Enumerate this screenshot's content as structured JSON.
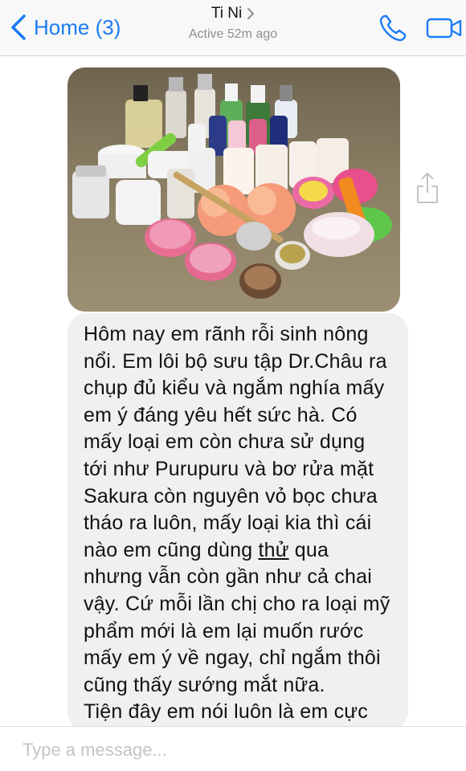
{
  "header": {
    "back_label": "Home (3)",
    "contact_name": "Ti Ni",
    "status": "Active 52m ago",
    "accent_color": "#1b7bf5",
    "icons": [
      "chevron-left-icon",
      "chevron-right-icon",
      "phone-icon",
      "video-camera-icon"
    ]
  },
  "messages": [
    {
      "type": "image",
      "sender": "contact",
      "icon": "share-icon"
    },
    {
      "type": "text",
      "sender": "contact",
      "text_before": "Hôm nay em rãnh rỗi sinh nông\nnổi. Em lôi bộ sưu tập Dr.Châu ra\nchụp đủ kiểu và ngắm nghía mấy\nem ý đáng yêu hết sức hà. Có\nmấy loại em còn chưa sử dụng\ntới như Purupuru và bơ rửa mặt\nSakura còn nguyên vỏ bọc chưa\ntháo ra luôn, mấy loại kia thì cái\nnào em cũng dùng ",
      "underlined": "thử",
      "text_after": " qua\nnhưng vẫn còn gần như cả chai\nvậy. Cứ mỗi lần chị cho ra loại mỹ\nphẩm mới là em lại muốn rước\nmấy em ý về ngay, chỉ ngắm thôi\ncũng thấy sướng mắt nữa.\nTiện đây em nói luôn là em cực"
    }
  ],
  "composer": {
    "placeholder": "Type a message..."
  }
}
